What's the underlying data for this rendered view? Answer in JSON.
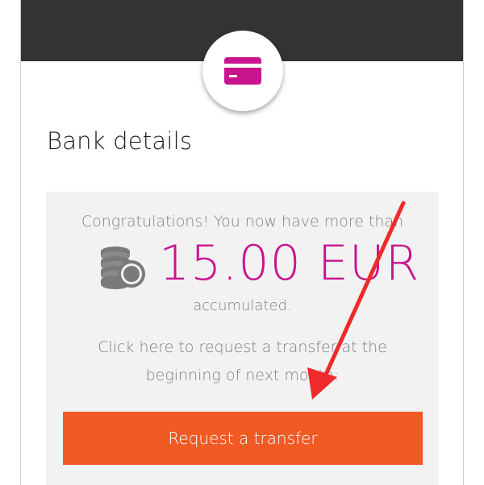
{
  "header": {
    "icon": "credit-card-icon"
  },
  "section": {
    "title": "Bank details"
  },
  "panel": {
    "congrats_text": "Congratulations! You now have more than",
    "coins_icon": "coins-icon",
    "amount": "15.00 EUR",
    "accumulated_text": "accumulated.",
    "request_text": "Click here to request a transfer at the beginning of next month:",
    "button_label": "Request a transfer"
  },
  "colors": {
    "header_band": "#333333",
    "accent_magenta": "#c8158e",
    "button_orange": "#f25a24",
    "annotation_arrow": "#ee2a2a"
  }
}
